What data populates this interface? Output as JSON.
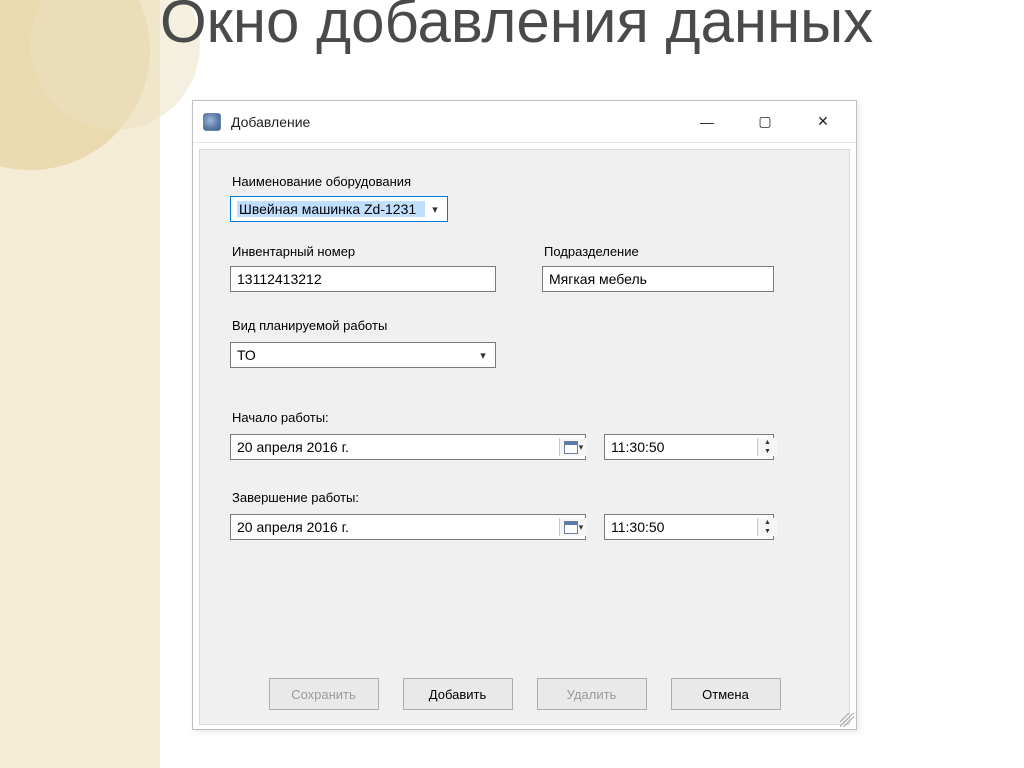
{
  "slide": {
    "title": "Окно добавления данных"
  },
  "window": {
    "title": "Добавление",
    "controls": {
      "minimize": "—",
      "maximize": "▢",
      "close": "✕"
    }
  },
  "form": {
    "equipment": {
      "label": "Наименование оборудования",
      "value": "Швейная машинка Zd-1231"
    },
    "inventory": {
      "label": "Инвентарный номер",
      "value": "13112413212"
    },
    "department": {
      "label": "Подразделение",
      "value": "Мягкая мебель"
    },
    "work_type": {
      "label": "Вид планируемой работы",
      "value": "ТО"
    },
    "start": {
      "label": "Начало работы:",
      "date": "20  апреля  2016 г.",
      "time": "11:30:50"
    },
    "end": {
      "label": "Завершение работы:",
      "date": "20  апреля  2016 г.",
      "time": "11:30:50"
    }
  },
  "buttons": {
    "save": "Сохранить",
    "add": "Добавить",
    "delete": "Удалить",
    "cancel": "Отмена"
  }
}
